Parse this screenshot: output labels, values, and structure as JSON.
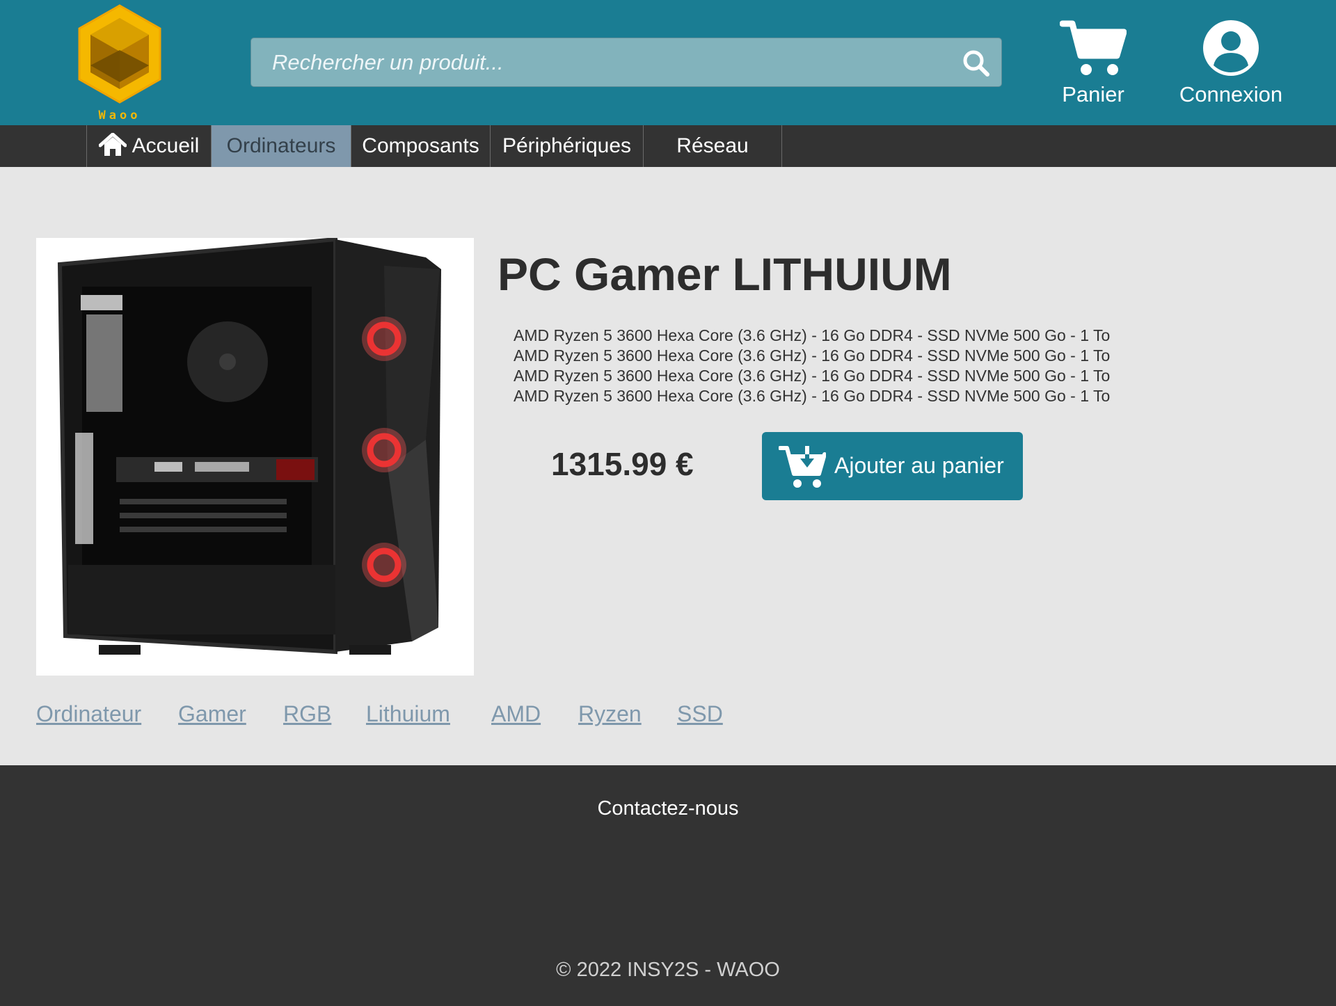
{
  "brand": {
    "logo_text": "Waoo",
    "logo_color": "#f2b705"
  },
  "colors": {
    "header": "#1a7d93",
    "nav": "#333333",
    "nav_active": "#7f98ac",
    "page_bg": "#e6e6e6",
    "tag": "#7f98ac"
  },
  "search": {
    "placeholder": "Rechercher un produit...",
    "icon": "search-icon"
  },
  "header": {
    "cart_label": "Panier",
    "cart_icon": "shopping-cart-icon",
    "login_label": "Connexion",
    "login_icon": "user-circle-icon"
  },
  "nav": {
    "items": [
      {
        "label": "Accueil",
        "icon": "home-icon"
      },
      {
        "label": "Ordinateurs",
        "active": true
      },
      {
        "label": "Composants"
      },
      {
        "label": "Périphériques"
      },
      {
        "label": "Réseau"
      }
    ]
  },
  "product": {
    "title": "PC Gamer LITHUIUM",
    "description_lines": [
      "AMD Ryzen 5 3600 Hexa Core (3.6 GHz) - 16 Go DDR4 - SSD NVMe 500 Go - 1 To",
      "AMD Ryzen 5 3600 Hexa Core (3.6 GHz) - 16 Go DDR4 - SSD NVMe 500 Go - 1 To",
      "AMD Ryzen 5 3600 Hexa Core (3.6 GHz) - 16 Go DDR4 - SSD NVMe 500 Go - 1 To",
      "AMD Ryzen 5 3600 Hexa Core (3.6 GHz) - 16 Go DDR4 - SSD NVMe 500 Go - 1 To"
    ],
    "price": "1315.99 €",
    "add_to_cart_label": "Ajouter au panier",
    "add_to_cart_icon": "cart-download-icon",
    "tags": [
      "Ordinateur",
      "Gamer",
      "RGB",
      "Lithuium",
      "AMD",
      "Ryzen",
      "SSD"
    ]
  },
  "footer": {
    "contact_label": "Contactez-nous",
    "copyright": "© 2022 INSY2S - WAOO"
  }
}
